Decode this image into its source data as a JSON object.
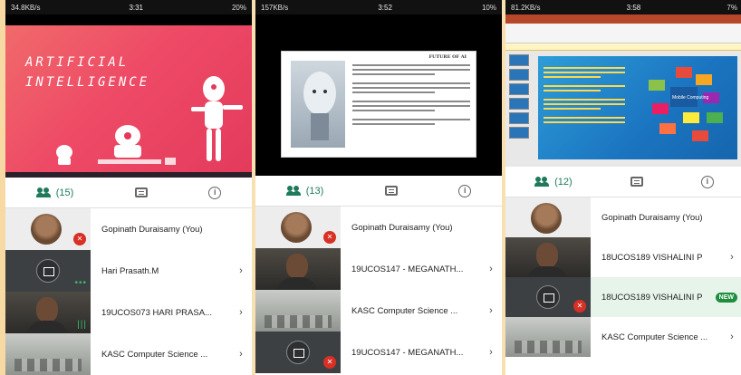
{
  "panels": [
    {
      "status": {
        "left": "34.8KB/s",
        "time": "3:31",
        "right": "20%"
      },
      "slide": {
        "title_line1": "ARTIFICIAL",
        "title_line2": "INTELLIGENCE"
      },
      "tabs": {
        "people_count": "(15)"
      },
      "participants": [
        {
          "name": "Gopinath Duraisamy (You)",
          "tile": "avatar",
          "muted": true
        },
        {
          "name": "Hari Prasath.M",
          "tile": "present"
        },
        {
          "name": "19UCOS073 HARI PRASA...",
          "tile": "camera"
        },
        {
          "name": "KASC Computer Science ...",
          "tile": "room"
        }
      ]
    },
    {
      "status": {
        "left": "157KB/s",
        "time": "3:52",
        "right": "10%"
      },
      "slide": {
        "title": "FUTURE OF AI"
      },
      "tabs": {
        "people_count": "(13)"
      },
      "participants": [
        {
          "name": "Gopinath Duraisamy (You)",
          "tile": "avatar",
          "muted": true
        },
        {
          "name": "19UCOS147 - MEGANATH...",
          "tile": "camera"
        },
        {
          "name": "KASC Computer Science ...",
          "tile": "room"
        },
        {
          "name": "19UCOS147 - MEGANATH...",
          "tile": "present"
        }
      ]
    },
    {
      "status": {
        "left": "81.2KB/s",
        "time": "3:58",
        "right": "7%"
      },
      "slide": {
        "title": "Mobile Computing"
      },
      "tabs": {
        "people_count": "(12)"
      },
      "participants": [
        {
          "name": "Gopinath Duraisamy (You)",
          "tile": "avatar"
        },
        {
          "name": "18UCOS189 VISHALINI P",
          "tile": "camera"
        },
        {
          "name": "18UCOS189 VISHALINI P",
          "tile": "present",
          "badge": "NEW"
        },
        {
          "name": "KASC Computer Science ...",
          "tile": "room"
        }
      ]
    }
  ],
  "colors": {
    "accent": "#1e7a5a",
    "muted": "#d93025",
    "new_badge": "#1e8e3e"
  },
  "icons": {
    "people": "people-icon",
    "chat": "chat-icon",
    "info": "info-icon",
    "chevron": "chevron-right-icon",
    "mic_off": "mic-off-icon",
    "present": "present-screen-icon"
  }
}
